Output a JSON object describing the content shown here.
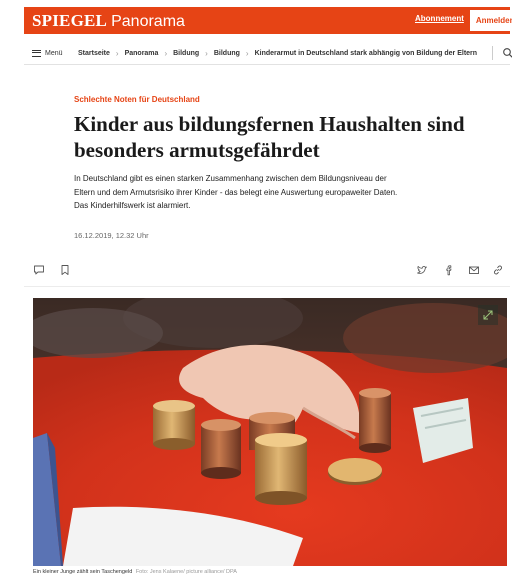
{
  "header": {
    "brand_main": "SPIEGEL",
    "brand_sub": "Panorama",
    "subscribe_label": "Abonnement",
    "login_label": "Anmelden",
    "login_chevron": "›",
    "accent_color": "#e64415"
  },
  "nav": {
    "menu_label": "Menü",
    "menu_icon": "hamburger-icon",
    "search_icon": "search-icon",
    "separator": "›",
    "breadcrumbs": [
      "Startseite",
      "Panorama",
      "Bildung",
      "Bildung",
      "Kinderarmut in Deutschland stark abhängig von Bildung der Eltern"
    ]
  },
  "article": {
    "kicker": "Schlechte Noten für Deutschland",
    "headline_line1": "Kinder aus bildungsfernen Haushalten sind",
    "headline_line2": "besonders armutsgefährdet",
    "lead_line1": "In Deutschland gibt es einen starken Zusammenhang zwischen dem Bildungsniveau der",
    "lead_line2": "Eltern und dem Armutsrisiko ihrer Kinder - das belegt eine Auswertung europaweiter Daten.",
    "lead_line3": "Das Kinderhilfswerk ist alarmiert.",
    "date": "16.12.2019, 12.32 Uhr"
  },
  "actions": {
    "left": [
      "comment-icon",
      "bookmark-icon"
    ],
    "right": [
      "twitter-icon",
      "facebook-icon",
      "mail-icon",
      "link-icon"
    ]
  },
  "image": {
    "caption": "Ein kleiner Junge zählt sein Taschengeld",
    "credit": "Foto: Jens Kalaene/ picture alliance/ DPA",
    "expand_icon": "expand-icon"
  }
}
